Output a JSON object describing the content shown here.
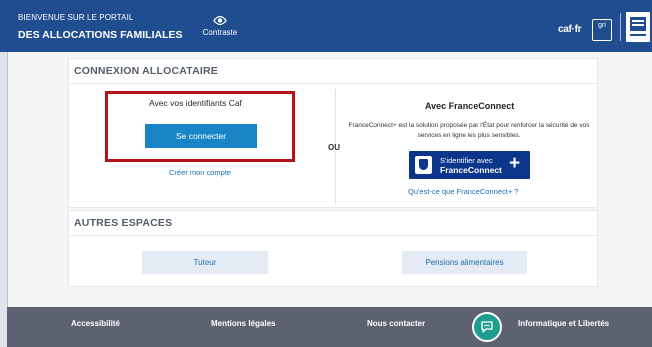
{
  "header": {
    "brand_top": "Bienvenue sur le portail",
    "brand_bottom": "des Allocations Familiales",
    "contrast_label": "Contraste",
    "caf_logo": "caf·fr",
    "gri_logo": "gri"
  },
  "login_section": {
    "title": "Connexion allocataire",
    "left_heading": "Avec vos identifiants Caf",
    "login_button": "Se connecter",
    "create_account_link": "Créer mon compte",
    "separator": "OU",
    "right_heading": "Avec FranceConnect",
    "right_description": "FranceConnect+ est la solution proposée par l'État pour renforcer la sécurité de vos services en ligne les plus sensibles.",
    "fc_button_line1": "S'identifier avec",
    "fc_button_line2": "FranceConnect",
    "fc_button_plus": "+",
    "fc_info_link": "Qu'est-ce que FranceConnect+ ?"
  },
  "other_spaces": {
    "title": "Autres espaces",
    "buttons": [
      "Tuteur",
      "Pensions alimentaires"
    ]
  },
  "footer": {
    "links": [
      "Accessibilité",
      "Mentions légales",
      "Nous contacter",
      "Informatique et Libertés"
    ]
  },
  "colors": {
    "header_bg": "#1f4d8f",
    "primary_button": "#1a85c6",
    "franceconnect": "#0c358c",
    "highlight_box": "#b0131a",
    "footer_bg": "#5d6270",
    "chat_bubble": "#1f9e8f"
  },
  "icons": {
    "contrast": "eye-icon",
    "chat": "chat-icon",
    "government": "marianne-logo",
    "franceconnect": "franceconnect-badge-icon"
  }
}
